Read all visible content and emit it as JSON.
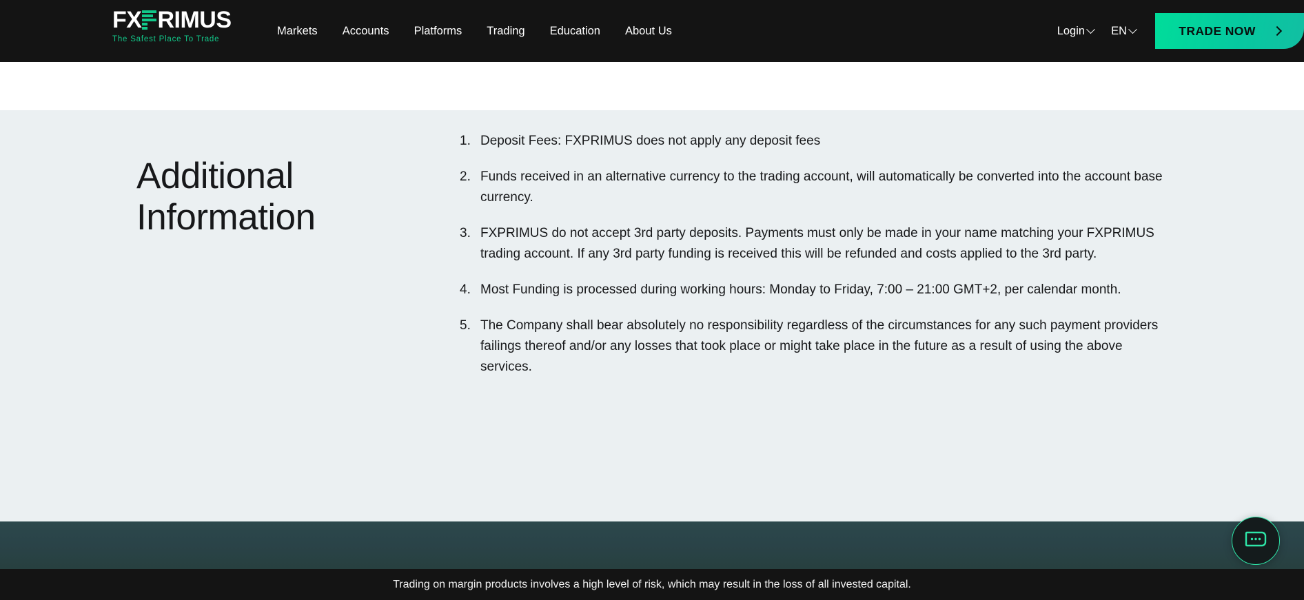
{
  "header": {
    "logo": {
      "prefix": "FX",
      "suffix": "RIMUS",
      "tagline": "The Safest Place To Trade",
      "accent_color": "#12c98a"
    },
    "nav": [
      {
        "label": "Markets"
      },
      {
        "label": "Accounts"
      },
      {
        "label": "Platforms"
      },
      {
        "label": "Trading"
      },
      {
        "label": "Education"
      },
      {
        "label": "About Us"
      }
    ],
    "login_label": "Login",
    "language_label": "EN",
    "cta_label": "TRADE NOW",
    "background_color": "#141414",
    "cta_color": "#00dd9a"
  },
  "main": {
    "background_color": "#ebf0f2",
    "heading": "Additional Information",
    "items": [
      {
        "number": "1.",
        "text": "Deposit Fees: FXPRIMUS does not apply any deposit fees"
      },
      {
        "number": "2.",
        "text": "Funds received in an alternative currency to the trading account, will automatically be converted into the account base currency."
      },
      {
        "number": "3.",
        "text": "FXPRIMUS do not accept 3rd party deposits. Payments must only be made in your name matching your FXPRIMUS trading account. If any 3rd party funding is received this will be refunded and costs applied to the 3rd party."
      },
      {
        "number": "4.",
        "text": "Most Funding is processed during working hours: Monday to Friday, 7:00 – 21:00 GMT+2, per calendar month."
      },
      {
        "number": "5.",
        "text": "The Company shall bear absolutely no responsibility regardless of the circumstances for any such payment providers failings thereof and/or any losses that took place or might take place in the future as a result of using the above services."
      }
    ]
  },
  "footer": {
    "band_color": "#2a4348",
    "disclaimer": "Trading on margin products involves a high level of risk, which may result in the loss of all invested capital.",
    "background_color": "#141414"
  },
  "chat": {
    "icon": "chat-bubble-icon",
    "border_color": "#2ee6a8"
  }
}
